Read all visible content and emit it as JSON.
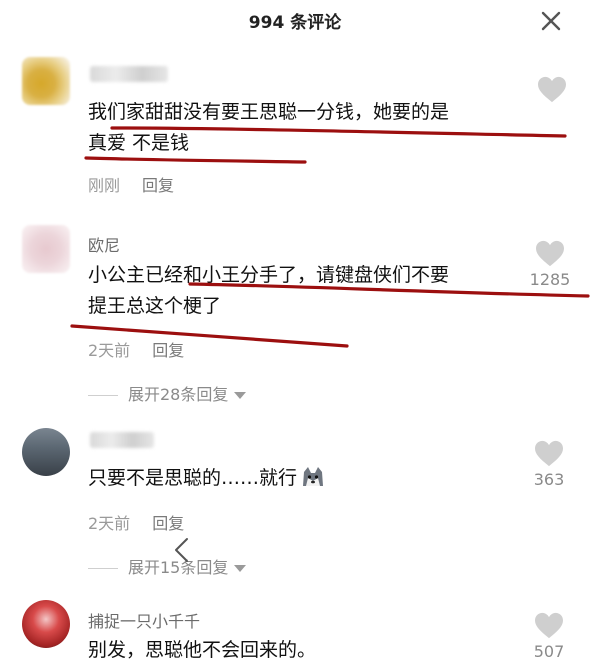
{
  "header": {
    "title": "994 条评论",
    "close_icon": "close-icon"
  },
  "comments": [
    {
      "username": "",
      "avatar": "blurred-avatar",
      "text_line1": "我们家甜甜没有要王思聪一分钱，她要的是",
      "text_line2": "真爱 不是钱",
      "time": "刚刚",
      "reply_label": "回复",
      "likes": ""
    },
    {
      "username": "欧尼",
      "avatar": "blurred-avatar",
      "text_line1": "小公主已经和小王分手了，请键盘侠们不要",
      "text_line2": "提王总这个梗了",
      "time": "2天前",
      "reply_label": "回复",
      "likes": "1285",
      "expand_label": "展开28条回复"
    },
    {
      "username": "",
      "avatar": "photo-avatar",
      "text": "只要不是思聪的……就行",
      "emoji": "husky-emoji",
      "time": "2天前",
      "reply_label": "回复",
      "likes": "363",
      "expand_label": "展开15条回复"
    },
    {
      "username": "捕捉一只小千千",
      "avatar": "photo-avatar",
      "text": "别发，思聪他不会回来的。",
      "likes": "507"
    }
  ],
  "colors": {
    "annotation_red": "#9c0f0f",
    "text_gray": "#9a9a9a",
    "heart_gray": "#d0d0d0"
  }
}
